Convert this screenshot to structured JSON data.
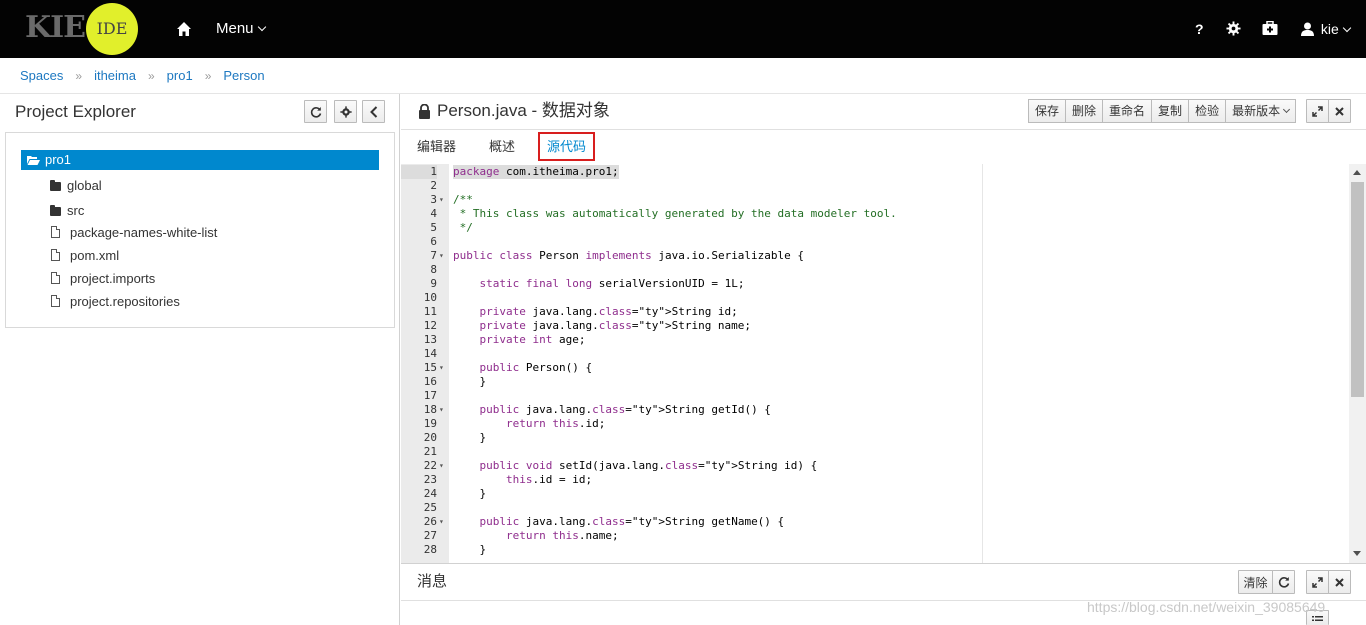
{
  "navbar": {
    "logo_kie": "KIE",
    "logo_ide": "IDE",
    "menu_label": "Menu",
    "help_label": "?",
    "user_label": "kie"
  },
  "breadcrumb": [
    "Spaces",
    "itheima",
    "pro1",
    "Person"
  ],
  "explorer": {
    "title": "Project Explorer",
    "root": "pro1",
    "items": [
      {
        "label": "global",
        "icon": "folder-icon"
      },
      {
        "label": "src",
        "icon": "folder-icon"
      },
      {
        "label": "package-names-white-list",
        "icon": "file-icon"
      },
      {
        "label": "pom.xml",
        "icon": "file-icon"
      },
      {
        "label": "project.imports",
        "icon": "file-icon"
      },
      {
        "label": "project.repositories",
        "icon": "file-icon"
      }
    ]
  },
  "editor": {
    "title": "Person.java - 数据对象",
    "buttons": {
      "save": "保存",
      "delete": "删除",
      "rename": "重命名",
      "copy": "复制",
      "validate": "检验",
      "latest": "最新版本"
    },
    "tabs": {
      "editor": "编辑器",
      "overview": "概述",
      "source": "源代码"
    }
  },
  "code_lines": [
    {
      "n": "1",
      "fold": false,
      "text": "package com.itheima.pro1;"
    },
    {
      "n": "2",
      "fold": false,
      "text": ""
    },
    {
      "n": "3",
      "fold": true,
      "text": "/**"
    },
    {
      "n": "4",
      "fold": false,
      "text": " * This class was automatically generated by the data modeler tool."
    },
    {
      "n": "5",
      "fold": false,
      "text": " */"
    },
    {
      "n": "6",
      "fold": false,
      "text": ""
    },
    {
      "n": "7",
      "fold": true,
      "text": "public class Person implements java.io.Serializable {"
    },
    {
      "n": "8",
      "fold": false,
      "text": ""
    },
    {
      "n": "9",
      "fold": false,
      "text": "    static final long serialVersionUID = 1L;"
    },
    {
      "n": "10",
      "fold": false,
      "text": ""
    },
    {
      "n": "11",
      "fold": false,
      "text": "    private java.lang.String id;"
    },
    {
      "n": "12",
      "fold": false,
      "text": "    private java.lang.String name;"
    },
    {
      "n": "13",
      "fold": false,
      "text": "    private int age;"
    },
    {
      "n": "14",
      "fold": false,
      "text": ""
    },
    {
      "n": "15",
      "fold": true,
      "text": "    public Person() {"
    },
    {
      "n": "16",
      "fold": false,
      "text": "    }"
    },
    {
      "n": "17",
      "fold": false,
      "text": ""
    },
    {
      "n": "18",
      "fold": true,
      "text": "    public java.lang.String getId() {"
    },
    {
      "n": "19",
      "fold": false,
      "text": "        return this.id;"
    },
    {
      "n": "20",
      "fold": false,
      "text": "    }"
    },
    {
      "n": "21",
      "fold": false,
      "text": ""
    },
    {
      "n": "22",
      "fold": true,
      "text": "    public void setId(java.lang.String id) {"
    },
    {
      "n": "23",
      "fold": false,
      "text": "        this.id = id;"
    },
    {
      "n": "24",
      "fold": false,
      "text": "    }"
    },
    {
      "n": "25",
      "fold": false,
      "text": ""
    },
    {
      "n": "26",
      "fold": true,
      "text": "    public java.lang.String getName() {"
    },
    {
      "n": "27",
      "fold": false,
      "text": "        return this.name;"
    },
    {
      "n": "28",
      "fold": false,
      "text": "    }"
    }
  ],
  "messages": {
    "title": "消息",
    "clear": "清除"
  },
  "watermark": "https://blog.csdn.net/weixin_39085649"
}
